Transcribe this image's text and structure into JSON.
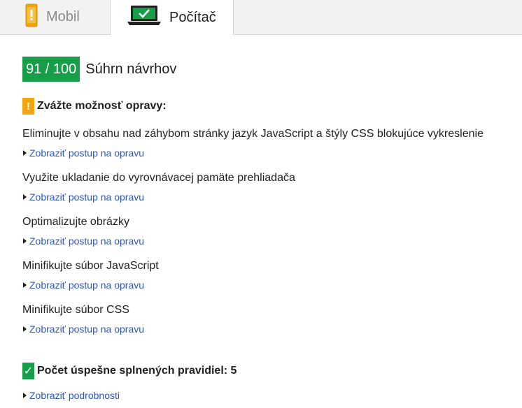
{
  "tabs": {
    "mobile": {
      "label": "Mobil",
      "icon": "smartphone-icon"
    },
    "desktop": {
      "label": "Počítač",
      "icon": "laptop-icon"
    }
  },
  "summary": {
    "score": "91 / 100",
    "title": "Súhrn návrhov",
    "score_color": "#169e49"
  },
  "warnings": {
    "badge": "!",
    "heading": "Zvážte možnosť opravy:",
    "color": "#f4a512",
    "rules": [
      {
        "title": "Eliminujte v obsahu nad záhybom stránky jazyk JavaScript a štýly CSS blokujúce vykreslenie",
        "link": "Zobraziť postup na opravu"
      },
      {
        "title": "Využite ukladanie do vyrovnávacej pamäte prehliadača",
        "link": "Zobraziť postup na opravu"
      },
      {
        "title": "Optimalizujte obrázky",
        "link": "Zobraziť postup na opravu"
      },
      {
        "title": "Minifikujte súbor JavaScript",
        "link": "Zobraziť postup na opravu"
      },
      {
        "title": "Minifikujte súbor CSS",
        "link": "Zobraziť postup na opravu"
      }
    ]
  },
  "passed": {
    "badge": "✓",
    "heading": "Počet úspešne splnených pravidiel: 5",
    "link": "Zobraziť podrobnosti"
  }
}
